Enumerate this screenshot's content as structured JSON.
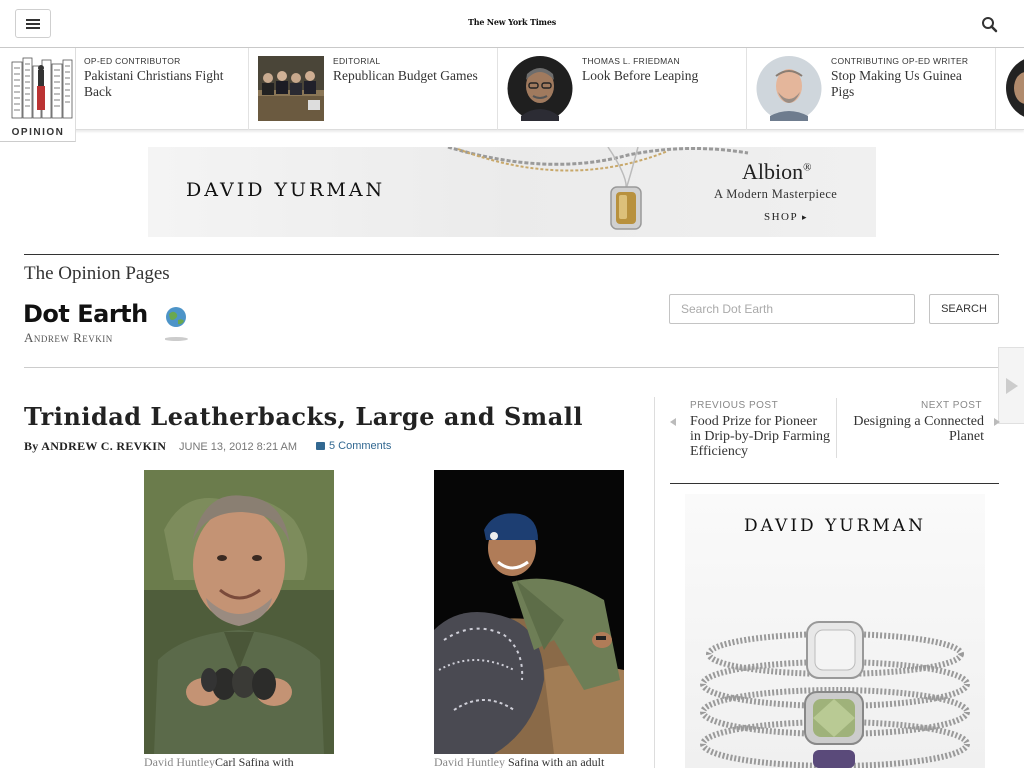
{
  "header": {
    "logo_text": "The New York Times",
    "menu_icon": "hamburger-icon",
    "search_icon": "magnifier-icon"
  },
  "ribbon": {
    "section_label": "OPINION",
    "items": [
      {
        "kicker": "OP-ED CONTRIBUTOR",
        "title": "Pakistani Christians Fight Back"
      },
      {
        "kicker": "EDITORIAL",
        "title": "Republican Budget Games"
      },
      {
        "kicker": "THOMAS L. FRIEDMAN",
        "title": "Look Before Leaping"
      },
      {
        "kicker": "CONTRIBUTING OP-ED WRITER",
        "title": "Stop Making Us Guinea Pigs"
      }
    ]
  },
  "ad_banner": {
    "brand": "DAVID YURMAN",
    "product": "Albion",
    "registered": "®",
    "tagline": "A Modern Masterpiece",
    "cta": "SHOP"
  },
  "section": {
    "title": "The Opinion Pages",
    "blog_name": "Dot Earth",
    "blog_author": "Andrew Revkin",
    "search_placeholder": "Search Dot Earth",
    "search_button": "SEARCH"
  },
  "article": {
    "headline": "Trinidad Leatherbacks, Large and Small",
    "byline_prefix": "By",
    "byline_name": "ANDREW C. REVKIN",
    "date": "JUNE 13, 2012 8:21 AM",
    "comments": "5 Comments",
    "photos": [
      {
        "credit": "David Huntley",
        "caption": "Carl Safina with"
      },
      {
        "credit": "David Huntley",
        "caption": "Safina with an adult"
      }
    ]
  },
  "post_nav": {
    "previous_label": "PREVIOUS POST",
    "previous_title": "Food Prize for Pioneer in Drip-by-Drip Farming Efficiency",
    "next_label": "NEXT POST",
    "next_title": "Designing a Connected Planet"
  },
  "ad_side": {
    "brand": "DAVID YURMAN"
  },
  "colors": {
    "link": "#326891",
    "text": "#333333",
    "rule": "#333333"
  }
}
